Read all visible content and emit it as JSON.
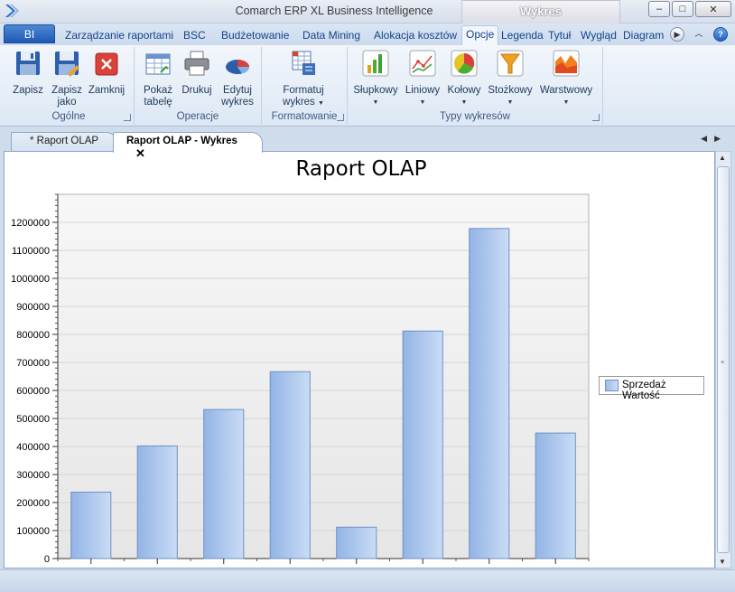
{
  "window": {
    "title": "Comarch ERP XL Business Intelligence",
    "context_tab_title": "Wykres",
    "controls": [
      "–",
      "□",
      "✕"
    ]
  },
  "ribbon_tabs": {
    "app_button": "BI",
    "tabs": [
      "Zarządzanie raportami",
      "BSC",
      "Budżetowanie",
      "Data Mining",
      "Alokacja kosztów",
      "Opcje",
      "Legenda",
      "Tytuł",
      "Wygląd",
      "Diagram"
    ],
    "active_tab": "Opcje"
  },
  "ribbon_groups": {
    "ogolne": {
      "label": "Ogólne",
      "buttons": {
        "zapisz": "Zapisz",
        "zapisz_jako": [
          "Zapisz",
          "jako"
        ],
        "zamknij": "Zamknij"
      }
    },
    "operacje": {
      "label": "Operacje",
      "buttons": {
        "pokaz_tabele": [
          "Pokaż",
          "tabelę"
        ],
        "drukuj": "Drukuj",
        "edytuj_wykres": [
          "Edytuj",
          "wykres"
        ]
      }
    },
    "formatowanie": {
      "label": "Formatowanie",
      "buttons": {
        "formatuj_wykres": [
          "Formatuj",
          "wykres"
        ]
      }
    },
    "typy": {
      "label": "Typy wykresów",
      "buttons": {
        "slupkowy": "Słupkowy",
        "liniowy": "Liniowy",
        "kolowy": "Kołowy",
        "stozkowy": "Stożkowy",
        "warstwowy": "Warstwowy"
      }
    }
  },
  "document_tabs": {
    "tab1": "* Raport OLAP",
    "tab2": "Raport OLAP - Wykres"
  },
  "colors": {
    "bar_light": "#c9dcf5",
    "bar_dark": "#93b4e6",
    "bar_border": "#6f90c2",
    "plot_bg": "#f0f0f0",
    "grid": "#d6d6d6"
  },
  "chart_data": {
    "type": "bar",
    "title": "Raport OLAP",
    "xlabel": "",
    "ylabel": "",
    "categories": [
      "",
      "",
      "",
      "",
      "",
      "",
      "",
      ""
    ],
    "series": [
      {
        "name": "Sprzedaż Wartość",
        "values": [
          237000,
          402000,
          532000,
          667000,
          112000,
          812000,
          1178000,
          448000
        ]
      }
    ],
    "ylim": [
      0,
      1300000
    ],
    "yticks": [
      0,
      100000,
      200000,
      300000,
      400000,
      500000,
      600000,
      700000,
      800000,
      900000,
      1000000,
      1100000,
      1200000
    ],
    "grid": true,
    "legend": "right"
  }
}
